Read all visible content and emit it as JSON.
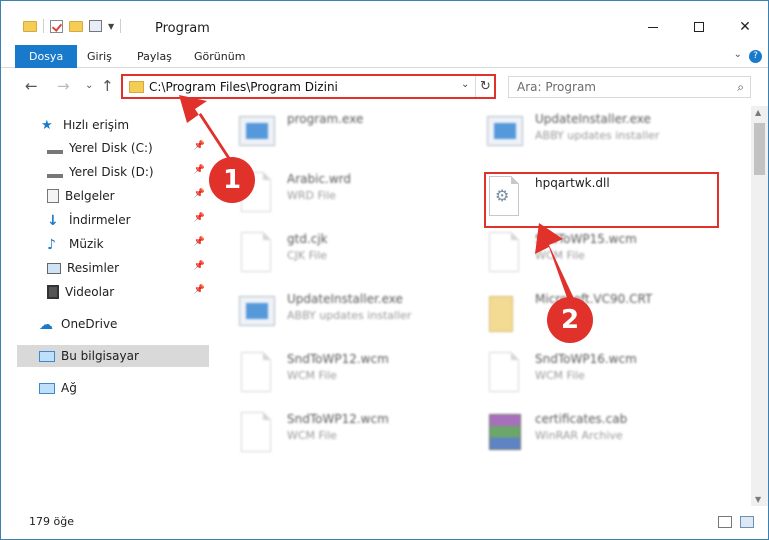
{
  "titlebar": {
    "title": "Program",
    "minimize": "—",
    "maximize": "",
    "close": "✕"
  },
  "ribbon": {
    "tabs": [
      "Dosya",
      "Giriş",
      "Paylaş",
      "Görünüm"
    ],
    "help": "?",
    "expand": "⌄"
  },
  "nav": {
    "back": "←",
    "forward": "→",
    "recent": "⌄",
    "up": "↑"
  },
  "address": {
    "path": "C:\\Program Files\\Program Dizini",
    "dropdown": "⌄",
    "refresh": "↻"
  },
  "search": {
    "placeholder": "Ara: Program",
    "icon": "⌕"
  },
  "sidebar": {
    "items": [
      {
        "label": "Hızlı erişim",
        "icon": "star-icon"
      },
      {
        "label": "Yerel Disk (C:)",
        "icon": "drive-icon"
      },
      {
        "label": "Yerel Disk (D:)",
        "icon": "drive-icon"
      },
      {
        "label": "Belgeler",
        "icon": "documents-icon"
      },
      {
        "label": "İndirmeler",
        "icon": "download-icon"
      },
      {
        "label": "Müzik",
        "icon": "music-icon"
      },
      {
        "label": "Resimler",
        "icon": "pictures-icon"
      },
      {
        "label": "Videolar",
        "icon": "videos-icon"
      },
      {
        "label": "OneDrive",
        "icon": "cloud-icon"
      },
      {
        "label": "Bu bilgisayar",
        "icon": "computer-icon"
      },
      {
        "label": "Ağ",
        "icon": "network-icon"
      }
    ],
    "pin": "📌"
  },
  "files": [
    {
      "name": "program.exe",
      "type": ""
    },
    {
      "name": "UpdateInstaller.exe",
      "type": "ABBY updates installer"
    },
    {
      "name": "Arabic.wrd",
      "type": "WRD File"
    },
    {
      "name": "hpqartwk.dll",
      "type": ""
    },
    {
      "name": "gtd.cjk",
      "type": "CJK File"
    },
    {
      "name": "SndToWP15.wcm",
      "type": "WCM File"
    },
    {
      "name": "UpdateInstaller.exe",
      "type": "ABBY updates installer"
    },
    {
      "name": "Microsoft.VC90.CRT",
      "type": ""
    },
    {
      "name": "SndToWP12.wcm",
      "type": "WCM File"
    },
    {
      "name": "SndToWP16.wcm",
      "type": "WCM File"
    },
    {
      "name": "SndToWP12.wcm",
      "type": "WCM File"
    },
    {
      "name": "certificates.cab",
      "type": "WinRAR Archive"
    }
  ],
  "status": {
    "count": "179 öğe"
  },
  "annotations": {
    "badge1": "1",
    "badge2": "2",
    "color": "#e0312a"
  },
  "scroll": {
    "up": "▲",
    "down": "▼"
  }
}
